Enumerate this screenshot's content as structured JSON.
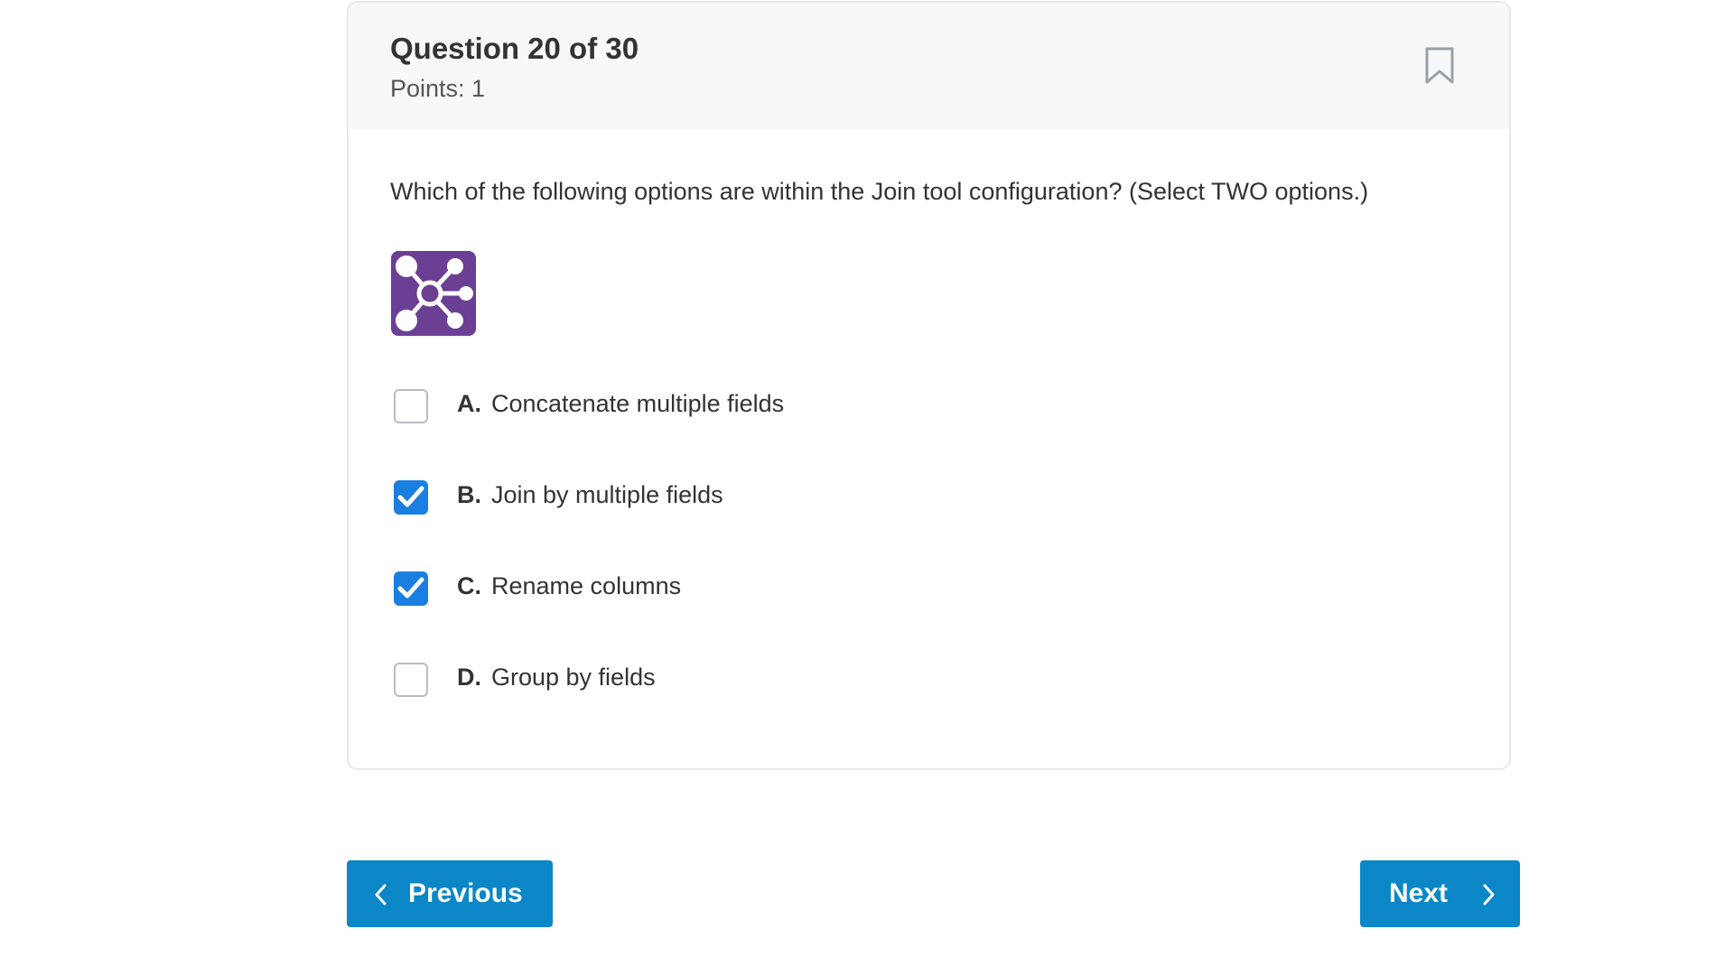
{
  "question": {
    "title": "Question 20 of 30",
    "points": "Points: 1",
    "text": "Which of the following options are within the Join tool configuration? (Select TWO options.)",
    "image_icon": "join-tool-icon"
  },
  "options": [
    {
      "letter": "A.",
      "label": "Concatenate multiple fields",
      "checked": false
    },
    {
      "letter": "B.",
      "label": "Join by multiple fields",
      "checked": true
    },
    {
      "letter": "C.",
      "label": "Rename columns",
      "checked": true
    },
    {
      "letter": "D.",
      "label": "Group by fields",
      "checked": false
    }
  ],
  "navigation": {
    "previous_label": "Previous",
    "next_label": "Next"
  },
  "icons": {
    "bookmark": "bookmark-icon",
    "previous": "chevron-left-icon",
    "next": "chevron-right-icon",
    "check": "checkmark-icon"
  },
  "colors": {
    "accent": "#0b87c8",
    "checkbox_checked": "#1a7fe0",
    "tool_icon": "#6b3f94",
    "header_bg": "#f7f8f9"
  }
}
